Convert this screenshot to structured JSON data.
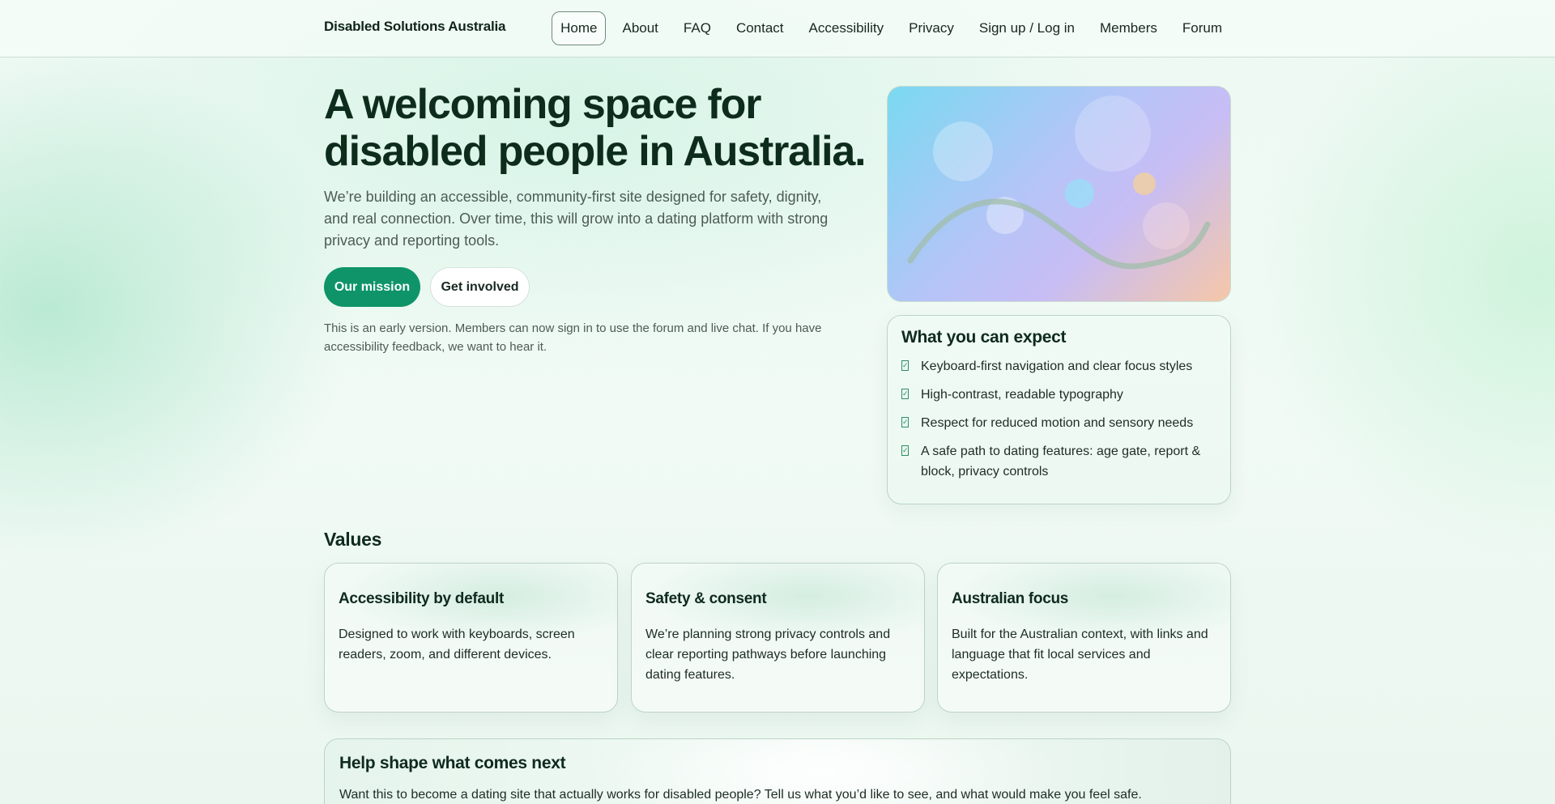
{
  "header": {
    "brand": "Disabled Solutions Australia",
    "nav": [
      {
        "label": "Home",
        "active": true
      },
      {
        "label": "About"
      },
      {
        "label": "FAQ"
      },
      {
        "label": "Contact"
      },
      {
        "label": "Accessibility"
      },
      {
        "label": "Privacy"
      },
      {
        "label": "Sign up / Log in"
      },
      {
        "label": "Members"
      },
      {
        "label": "Forum"
      }
    ]
  },
  "hero": {
    "title": "A welcoming space for disabled people in Australia.",
    "lead": "We’re building an accessible, community-first site designed for safety, dignity, and real connection. Over time, this will grow into a dating platform with strong privacy and reporting tools.",
    "primary_button": "Our mission",
    "secondary_button": "Get involved",
    "note": "This is an early version. Members can now sign in to use the forum and live chat. If you have accessibility feedback, we want to hear it."
  },
  "expect": {
    "title": "What you can expect",
    "items": [
      "Keyboard-first navigation and clear focus styles",
      "High-contrast, readable typography",
      "Respect for reduced motion and sensory needs",
      "A safe path to dating features: age gate, report & block, privacy controls"
    ]
  },
  "values": {
    "title": "Values",
    "cards": [
      {
        "title": "Accessibility by default",
        "text": "Designed to work with keyboards, screen readers, zoom, and different devices."
      },
      {
        "title": "Safety & consent",
        "text": "We’re planning strong privacy controls and clear reporting pathways before launching dating features."
      },
      {
        "title": "Australian focus",
        "text": "Built for the Australian context, with links and language that fit local services and expectations."
      }
    ]
  },
  "help": {
    "title": "Help shape what comes next",
    "text": "Want this to become a dating site that actually works for disabled people? Tell us what you’d like to see, and what would make you feel safe."
  },
  "colors": {
    "accent": "#0e9468",
    "text": "#0f2a1e",
    "muted": "#4d5b55"
  }
}
